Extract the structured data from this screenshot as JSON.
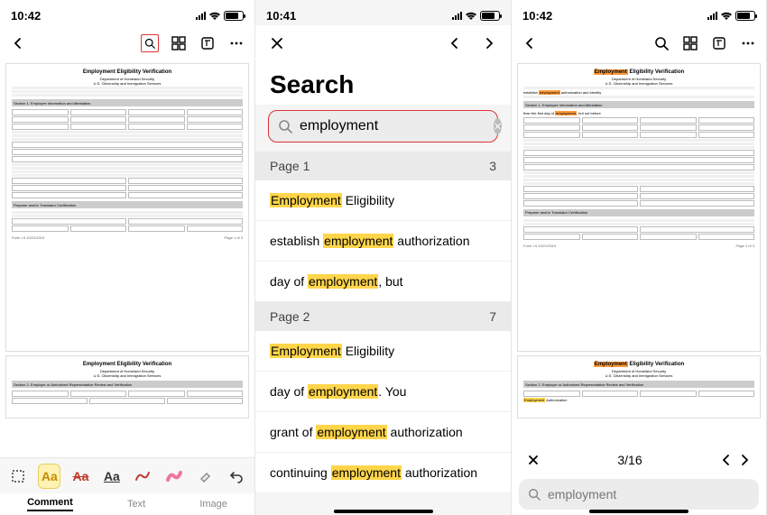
{
  "status": {
    "time_left": "10:42",
    "time_mid": "10:41",
    "time_right": "10:42"
  },
  "left": {
    "doc_title": "Employment Eligibility Verification",
    "doc_sub1": "Department of Homeland Security",
    "doc_sub2": "U.S. Citizenship and Immigration Services",
    "section1": "Section 1. Employee Information and Attestation",
    "section2": "Section 2. Employer or Authorized Representative Review and Verification",
    "form_no": "Form I-9 10/21/2019",
    "page_of": "Page 1 of 3",
    "tools_aa": "Aa",
    "tabs": {
      "comment": "Comment",
      "text": "Text",
      "image": "Image"
    }
  },
  "mid": {
    "heading": "Search",
    "query": "employment",
    "groups": [
      {
        "label": "Page 1",
        "count": "3"
      },
      {
        "label": "Page 2",
        "count": "7"
      }
    ],
    "results_p1": [
      {
        "pre": "",
        "hl": "Employment",
        "post": " Eligibility"
      },
      {
        "pre": "establish ",
        "hl": "employment",
        "post": " authorization"
      },
      {
        "pre": "day of ",
        "hl": "employment",
        "post": ", but"
      }
    ],
    "results_p2": [
      {
        "pre": "",
        "hl": "Employment",
        "post": " Eligibility"
      },
      {
        "pre": "day of ",
        "hl": "employment",
        "post": ". You"
      },
      {
        "pre": "grant of ",
        "hl": "employment",
        "post": " authorization"
      },
      {
        "pre": "continuing ",
        "hl": "employment",
        "post": " authorization"
      }
    ]
  },
  "right": {
    "counter": "3/16",
    "query": "employment"
  }
}
